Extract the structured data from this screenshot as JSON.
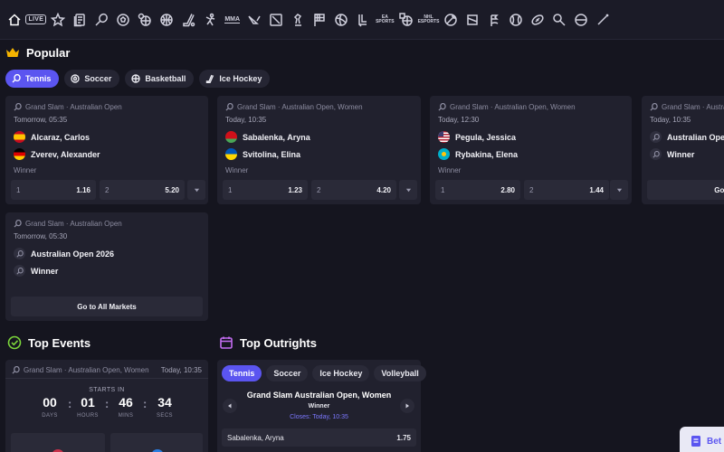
{
  "sport_bar": {
    "live_label": "LIVE",
    "mma_label": "MMA",
    "icons": [
      "home-icon",
      "live-icon",
      "star-icon",
      "betslip-history-icon",
      "tennis-icon",
      "soccer-icon",
      "basketball-multi-icon",
      "basketball-icon",
      "hockey-icon",
      "cricket-icon",
      "mma-icon",
      "valorant-icon",
      "dota-icon",
      "chess-icon",
      "racing-flag-icon",
      "volleyball-icon",
      "esports-icon",
      "esoccer-icon",
      "ebasketball-icon",
      "eshockey-icon",
      "ebattles-icon",
      "handball-icon",
      "golf-icon",
      "baseball-icon",
      "rugby-icon",
      "table-tennis-icon"
    ]
  },
  "popular": {
    "title": "Popular",
    "tabs": [
      {
        "label": "Tennis",
        "active": true
      },
      {
        "label": "Soccer",
        "active": false
      },
      {
        "label": "Basketball",
        "active": false
      },
      {
        "label": "Ice Hockey",
        "active": false
      }
    ]
  },
  "cards": [
    {
      "league": "Grand Slam · Australian Open",
      "time": "Tomorrow, 05:35",
      "team1": "Alcaraz, Carlos",
      "team2": "Zverev, Alexander",
      "market": "Winner",
      "odd1_label": "1",
      "odd1": "1.16",
      "odd2_label": "2",
      "odd2": "5.20"
    },
    {
      "league": "Grand Slam · Australian Open, Women",
      "time": "Today, 10:35",
      "team1": "Sabalenka, Aryna",
      "team2": "Svitolina, Elina",
      "market": "Winner",
      "odd1_label": "1",
      "odd1": "1.23",
      "odd2_label": "2",
      "odd2": "4.20"
    },
    {
      "league": "Grand Slam · Australian Open, Women",
      "time": "Today, 12:30",
      "team1": "Pegula, Jessica",
      "team2": "Rybakina, Elena",
      "market": "Winner",
      "odd1_label": "1",
      "odd1": "2.80",
      "odd2_label": "2",
      "odd2": "1.44"
    },
    {
      "league": "Grand Slam · Australian Open",
      "time": "Today, 10:35",
      "team1": "Australian Open",
      "team2": "Winner",
      "button": "Go to All Markets"
    },
    {
      "league": "Grand Slam · Australian Open",
      "time": "Tomorrow, 05:30",
      "team1": "Australian Open 2026",
      "team2": "Winner",
      "button": "Go to All Markets"
    }
  ],
  "top_events": {
    "title": "Top Events",
    "league": "Grand Slam · Australian Open, Women",
    "time": "Today, 10:35",
    "starts_label": "STARTS IN",
    "countdown": [
      {
        "value": "00",
        "unit": "DAYS"
      },
      {
        "value": "01",
        "unit": "HOURS"
      },
      {
        "value": "46",
        "unit": "MINS"
      },
      {
        "value": "34",
        "unit": "SECS"
      }
    ]
  },
  "top_outrights": {
    "title": "Top Outrights",
    "tabs": [
      {
        "label": "Tennis",
        "active": true
      },
      {
        "label": "Soccer",
        "active": false
      },
      {
        "label": "Ice Hockey",
        "active": false
      },
      {
        "label": "Volleyball",
        "active": false
      }
    ],
    "event": "Grand Slam Australian Open, Women",
    "market": "Winner",
    "closes": "Closes: Today, 10:35",
    "rows": [
      {
        "name": "Sabalenka, Aryna",
        "odd": "1.75"
      }
    ]
  },
  "betslip": {
    "label": "Bet"
  },
  "colors": {
    "accent": "#5b55f0",
    "background": "#15151f",
    "card": "#21212e",
    "popular_icon": "#f5b400",
    "top_events_icon": "#7cd63b",
    "top_outrights_icon": "#c46df2"
  }
}
